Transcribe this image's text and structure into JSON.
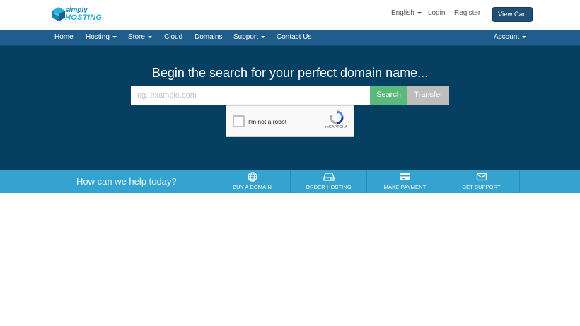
{
  "brand": {
    "line1": "simply",
    "line2": "HOSTING"
  },
  "top_links": {
    "language": "English",
    "login": "Login",
    "register": "Register"
  },
  "cart": {
    "label": "View Cart"
  },
  "nav": {
    "items": [
      {
        "label": "Home"
      },
      {
        "label": "Hosting"
      },
      {
        "label": "Store"
      },
      {
        "label": "Cloud"
      },
      {
        "label": "Domains"
      },
      {
        "label": "Support"
      },
      {
        "label": "Contact Us"
      }
    ],
    "account": "Account"
  },
  "hero": {
    "title": "Begin the search for your perfect domain name...",
    "placeholder": "eg. example.com",
    "search_label": "Search",
    "transfer_label": "Transfer"
  },
  "captcha": {
    "label": "I'm not a robot",
    "brand": "reCAPTCHA"
  },
  "help": {
    "text": "How can we help today?",
    "buttons": [
      {
        "label": "BUY A DOMAIN",
        "icon": "globe-icon"
      },
      {
        "label": "ORDER HOSTING",
        "icon": "server-icon"
      },
      {
        "label": "MAKE PAYMENT",
        "icon": "credit-card-icon"
      },
      {
        "label": "GET SUPPORT",
        "icon": "envelope-icon"
      }
    ]
  },
  "colors": {
    "nav_bg": "#1f5e8c",
    "hero_bg": "#054063",
    "help_bg": "#34a3cf",
    "search_btn": "#5cb97c",
    "transfer_btn": "#bdbdbd",
    "cart_btn": "#1f5074"
  }
}
